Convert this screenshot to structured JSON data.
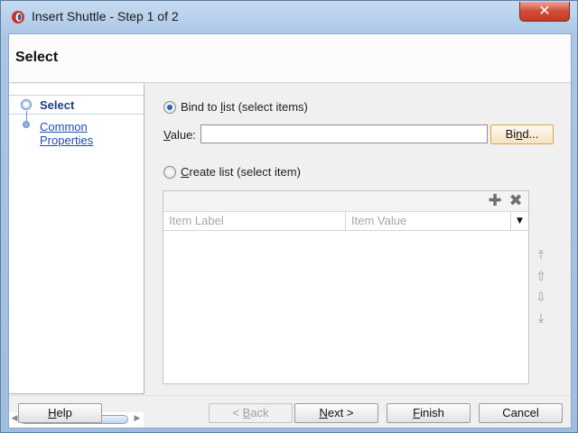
{
  "window": {
    "title": "Insert Shuttle - Step 1 of 2",
    "close_glyph": "✕"
  },
  "header": {
    "title": "Select"
  },
  "nav": {
    "items": [
      {
        "label": "Select",
        "selected": true
      },
      {
        "label": "Common Properties",
        "selected": false
      }
    ],
    "scroll_left": "◀",
    "scroll_right": "▶"
  },
  "bind_option": {
    "label_pre": "Bind to ",
    "label_mn": "l",
    "label_post": "ist (select items)",
    "checked": true
  },
  "value_field": {
    "label_mn": "V",
    "label_post": "alue:",
    "value": ""
  },
  "bind_button": {
    "label_pre": "Bi",
    "label_mn": "n",
    "label_post": "d..."
  },
  "create_option": {
    "label_mn": "C",
    "label_post": "reate list (select item)",
    "checked": false
  },
  "table": {
    "columns": [
      "Item Label",
      "Item Value"
    ],
    "add_icon": "✚",
    "delete_icon": "✖",
    "column_menu_icon": "▼"
  },
  "move_icons": {
    "top": "⤒",
    "up": "⇧",
    "down": "⇩",
    "bottom": "⤓"
  },
  "footer": {
    "help": {
      "mn": "H",
      "post": "elp"
    },
    "back": {
      "pre": "< ",
      "mn": "B",
      "post": "ack",
      "disabled": true
    },
    "next": {
      "mn": "N",
      "post": "ext >"
    },
    "finish": {
      "mn": "F",
      "post": "inish"
    },
    "cancel": "Cancel"
  },
  "colors": {
    "accent_link": "#1a4fa8",
    "selected_text": "#1c3f80",
    "radio_dot": "#2b63b5",
    "focus_border": "#e0a640"
  }
}
